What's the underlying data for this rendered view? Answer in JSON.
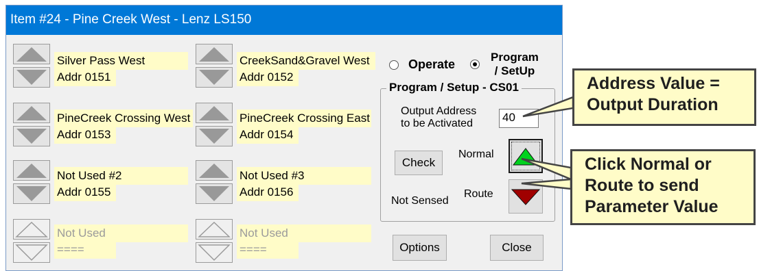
{
  "window": {
    "title": "Item #24 - Pine Creek West - Lenz LS150"
  },
  "accessories": [
    {
      "name": "Silver Pass West",
      "addr": "Addr 0151",
      "enabled": true
    },
    {
      "name": "CreekSand&Gravel West",
      "addr": "Addr 0152",
      "enabled": true
    },
    {
      "name": "PineCreek Crossing West",
      "addr": "Addr 0153",
      "enabled": true
    },
    {
      "name": "PineCreek Crossing East",
      "addr": "Addr 0154",
      "enabled": true
    },
    {
      "name": "Not Used #2",
      "addr": "Addr 0155",
      "enabled": true
    },
    {
      "name": "Not Used #3",
      "addr": "Addr 0156",
      "enabled": true
    },
    {
      "name": "Not Used",
      "addr": "====",
      "enabled": false
    },
    {
      "name": "Not Used",
      "addr": "====",
      "enabled": false
    }
  ],
  "mode": {
    "operate_label": "Operate",
    "program_label_line1": "Program",
    "program_label_line2": "/ SetUp",
    "selected": "program"
  },
  "program_setup": {
    "title": "Program / Setup  -  CS01",
    "output_address_line1": "Output Address",
    "output_address_line2": "to be Activated",
    "output_address_value": "40",
    "check_label": "Check",
    "normal_label": "Normal",
    "route_label": "Route",
    "sensed_status": "Not Sensed",
    "colors": {
      "normal": "#00d21e",
      "route": "#a00000"
    }
  },
  "buttons": {
    "options_label": "Options",
    "close_label": "Close"
  },
  "callouts": {
    "address": {
      "line1": "Address Value =",
      "line2": "Output Duration"
    },
    "click": {
      "line1": "Click Normal or",
      "line2": "Route to send",
      "line3": "Parameter Value"
    }
  },
  "icons": {
    "up": "triangle-up-icon",
    "down": "triangle-down-icon"
  }
}
